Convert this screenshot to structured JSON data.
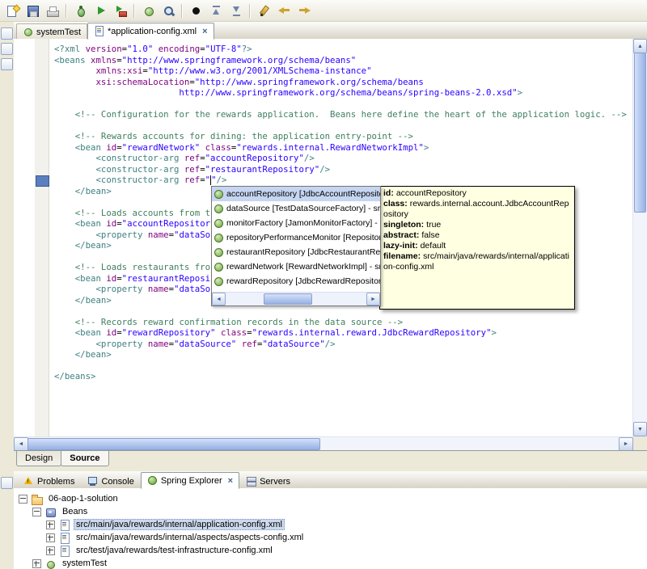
{
  "chrome": {
    "close": "×",
    "scroll_up": "▲",
    "scroll_down": "▼",
    "scroll_left": "◄",
    "scroll_right": "►"
  },
  "colors": {
    "window_bg": "#ece9d8",
    "tooltip_bg": "#ffffe1",
    "popup_selection": "#c6d5f1",
    "tree_selection": "#ccd9ed",
    "tag_color": "#3f7f7f",
    "attribute_color": "#7f007f",
    "value_color": "#2a00ff",
    "comment_color": "#3f7f5f"
  },
  "toolbar": {
    "items": [
      {
        "type": "icon",
        "name": "new-wizard"
      },
      {
        "type": "icon",
        "name": "save"
      },
      {
        "type": "icon",
        "name": "print"
      },
      {
        "type": "sep"
      },
      {
        "type": "icon",
        "name": "debug"
      },
      {
        "type": "icon",
        "name": "run"
      },
      {
        "type": "icon",
        "name": "external-tools"
      },
      {
        "type": "sep"
      },
      {
        "type": "icon",
        "name": "new-bean"
      },
      {
        "type": "icon",
        "name": "search"
      },
      {
        "type": "sep"
      },
      {
        "type": "icon",
        "name": "record"
      },
      {
        "type": "icon",
        "name": "prev-annotation"
      },
      {
        "type": "icon",
        "name": "next-annotation"
      },
      {
        "type": "sep"
      },
      {
        "type": "icon",
        "name": "last-edit-location"
      },
      {
        "type": "icon",
        "name": "back"
      },
      {
        "type": "icon",
        "name": "forward"
      }
    ]
  },
  "left_rail": {
    "icons": [
      {
        "name": "restore-fast-view-icon",
        "slot": "top"
      },
      {
        "name": "package-explorer-fast-view-icon",
        "slot": "top"
      },
      {
        "name": "outline-fast-view-icon",
        "slot": "top"
      },
      {
        "name": "spring-fast-view-icon",
        "slot": "bottom"
      }
    ]
  },
  "editor_tabs": [
    {
      "label": "systemTest",
      "icon": "eti-bean-file-icon",
      "active": false,
      "closable": false
    },
    {
      "label": "*application-config.xml",
      "icon": "eti-xml-file-icon",
      "active": true,
      "closable": true
    }
  ],
  "editor": {
    "lines": [
      [
        {
          "c": "tag",
          "t": "<?xml "
        },
        {
          "c": "attr",
          "t": "version"
        },
        {
          "c": "txt",
          "t": "="
        },
        {
          "c": "val",
          "t": "\"1.0\""
        },
        {
          "c": "txt",
          "t": " "
        },
        {
          "c": "attr",
          "t": "encoding"
        },
        {
          "c": "txt",
          "t": "="
        },
        {
          "c": "val",
          "t": "\"UTF-8\""
        },
        {
          "c": "tag",
          "t": "?>"
        }
      ],
      [
        {
          "c": "tag",
          "t": "<beans "
        },
        {
          "c": "attr",
          "t": "xmlns"
        },
        {
          "c": "txt",
          "t": "="
        },
        {
          "c": "val",
          "t": "\"http://www.springframework.org/schema/beans\""
        }
      ],
      [
        {
          "c": "txt",
          "t": "        "
        },
        {
          "c": "attr",
          "t": "xmlns:xsi"
        },
        {
          "c": "txt",
          "t": "="
        },
        {
          "c": "val",
          "t": "\"http://www.w3.org/2001/XMLSchema-instance\""
        }
      ],
      [
        {
          "c": "txt",
          "t": "        "
        },
        {
          "c": "attr",
          "t": "xsi:schemaLocation"
        },
        {
          "c": "txt",
          "t": "="
        },
        {
          "c": "val",
          "t": "\"http://www.springframework.org/schema/beans"
        }
      ],
      [
        {
          "c": "val",
          "t": "                        http://www.springframework.org/schema/beans/spring-beans-2.0.xsd\""
        },
        {
          "c": "tag",
          "t": ">"
        }
      ],
      [],
      [
        {
          "c": "txt",
          "t": "    "
        },
        {
          "c": "com",
          "t": "<!-- Configuration for the rewards application.  Beans here define the heart of the application logic. -->"
        }
      ],
      [],
      [
        {
          "c": "txt",
          "t": "    "
        },
        {
          "c": "com",
          "t": "<!-- Rewards accounts for dining: the application entry-point -->"
        }
      ],
      [
        {
          "c": "txt",
          "t": "    "
        },
        {
          "c": "tag",
          "t": "<bean "
        },
        {
          "c": "attr",
          "t": "id"
        },
        {
          "c": "txt",
          "t": "="
        },
        {
          "c": "val",
          "t": "\"rewardNetwork\""
        },
        {
          "c": "txt",
          "t": " "
        },
        {
          "c": "attr",
          "t": "class"
        },
        {
          "c": "txt",
          "t": "="
        },
        {
          "c": "val",
          "t": "\"rewards.internal.RewardNetworkImpl\""
        },
        {
          "c": "tag",
          "t": ">"
        }
      ],
      [
        {
          "c": "txt",
          "t": "        "
        },
        {
          "c": "tag",
          "t": "<constructor-arg "
        },
        {
          "c": "attr",
          "t": "ref"
        },
        {
          "c": "txt",
          "t": "="
        },
        {
          "c": "val",
          "t": "\"accountRepository\""
        },
        {
          "c": "tag",
          "t": "/>"
        }
      ],
      [
        {
          "c": "txt",
          "t": "        "
        },
        {
          "c": "tag",
          "t": "<constructor-arg "
        },
        {
          "c": "attr",
          "t": "ref"
        },
        {
          "c": "txt",
          "t": "="
        },
        {
          "c": "val",
          "t": "\"restaurantRepository\""
        },
        {
          "c": "tag",
          "t": "/>"
        }
      ],
      [
        {
          "c": "txt",
          "t": "        "
        },
        {
          "c": "tag",
          "t": "<constructor-arg "
        },
        {
          "c": "attr",
          "t": "ref"
        },
        {
          "c": "txt",
          "t": "="
        },
        {
          "c": "val",
          "t": "\""
        },
        {
          "caret": true
        },
        {
          "c": "val",
          "t": "\""
        },
        {
          "c": "tag",
          "t": "/>"
        }
      ],
      [
        {
          "c": "txt",
          "t": "    "
        },
        {
          "c": "tag",
          "t": "</bean>"
        }
      ],
      [],
      [
        {
          "c": "txt",
          "t": "    "
        },
        {
          "c": "com",
          "t": "<!-- Loads accounts from t"
        }
      ],
      [
        {
          "c": "txt",
          "t": "    "
        },
        {
          "c": "tag",
          "t": "<bean "
        },
        {
          "c": "attr",
          "t": "id"
        },
        {
          "c": "txt",
          "t": "="
        },
        {
          "c": "val",
          "t": "\"accountRepositor"
        }
      ],
      [
        {
          "c": "txt",
          "t": "        "
        },
        {
          "c": "tag",
          "t": "<property "
        },
        {
          "c": "attr",
          "t": "name"
        },
        {
          "c": "txt",
          "t": "="
        },
        {
          "c": "val",
          "t": "\"dataSo"
        }
      ],
      [
        {
          "c": "txt",
          "t": "    "
        },
        {
          "c": "tag",
          "t": "</bean>"
        }
      ],
      [],
      [
        {
          "c": "txt",
          "t": "    "
        },
        {
          "c": "com",
          "t": "<!-- Loads restaurants fro"
        }
      ],
      [
        {
          "c": "txt",
          "t": "    "
        },
        {
          "c": "tag",
          "t": "<bean "
        },
        {
          "c": "attr",
          "t": "id"
        },
        {
          "c": "txt",
          "t": "="
        },
        {
          "c": "val",
          "t": "\"restaurantReposi"
        }
      ],
      [
        {
          "c": "txt",
          "t": "        "
        },
        {
          "c": "tag",
          "t": "<property "
        },
        {
          "c": "attr",
          "t": "name"
        },
        {
          "c": "txt",
          "t": "="
        },
        {
          "c": "val",
          "t": "\"dataSo"
        }
      ],
      [
        {
          "c": "txt",
          "t": "    "
        },
        {
          "c": "tag",
          "t": "</bean>"
        }
      ],
      [],
      [
        {
          "c": "txt",
          "t": "    "
        },
        {
          "c": "com",
          "t": "<!-- Records reward confirmation records in the data source -->"
        }
      ],
      [
        {
          "c": "txt",
          "t": "    "
        },
        {
          "c": "tag",
          "t": "<bean "
        },
        {
          "c": "attr",
          "t": "id"
        },
        {
          "c": "txt",
          "t": "="
        },
        {
          "c": "val",
          "t": "\"rewardRepository\""
        },
        {
          "c": "txt",
          "t": " "
        },
        {
          "c": "attr",
          "t": "class"
        },
        {
          "c": "txt",
          "t": "="
        },
        {
          "c": "val",
          "t": "\"rewards.internal.reward.JdbcRewardRepository\""
        },
        {
          "c": "tag",
          "t": ">"
        }
      ],
      [
        {
          "c": "txt",
          "t": "        "
        },
        {
          "c": "tag",
          "t": "<property "
        },
        {
          "c": "attr",
          "t": "name"
        },
        {
          "c": "txt",
          "t": "="
        },
        {
          "c": "val",
          "t": "\"dataSource\""
        },
        {
          "c": "txt",
          "t": " "
        },
        {
          "c": "attr",
          "t": "ref"
        },
        {
          "c": "txt",
          "t": "="
        },
        {
          "c": "val",
          "t": "\"dataSource\""
        },
        {
          "c": "tag",
          "t": "/>"
        }
      ],
      [
        {
          "c": "txt",
          "t": "    "
        },
        {
          "c": "tag",
          "t": "</bean>"
        }
      ],
      [],
      [
        {
          "c": "tag",
          "t": "</beans>"
        }
      ]
    ]
  },
  "popup": {
    "items": [
      {
        "label": "accountRepository [JdbcAccountRepository] - src/m",
        "selected": true
      },
      {
        "label": "dataSource [TestDataSourceFactory] - src/test/ja",
        "selected": false
      },
      {
        "label": "monitorFactory [JamonMonitorFactory] - src/main",
        "selected": false
      },
      {
        "label": "repositoryPerformanceMonitor [RepositoryPerfor",
        "selected": false
      },
      {
        "label": "restaurantRepository [JdbcRestaurantRepository]",
        "selected": false
      },
      {
        "label": "rewardNetwork [RewardNetworkImpl] - src/main/j",
        "selected": false
      },
      {
        "label": "rewardRepository [JdbcRewardRepository] - src/m",
        "selected": false
      }
    ]
  },
  "tooltip": {
    "rows": [
      {
        "label": "id:",
        "value": "accountRepository"
      },
      {
        "label": "class:",
        "value": "rewards.internal.account.JdbcAccountRepository"
      },
      {
        "label": "singleton:",
        "value": "true"
      },
      {
        "label": "abstract:",
        "value": "false"
      },
      {
        "label": "lazy-init:",
        "value": "default"
      },
      {
        "label": "filename:",
        "value": "src/main/java/rewards/internal/application-config.xml"
      }
    ]
  },
  "source_tabs": [
    {
      "label": "Design",
      "active": false
    },
    {
      "label": "Source",
      "active": true
    }
  ],
  "bottom_tabs": [
    {
      "label": "Problems",
      "icon": "bti-problems-icon",
      "active": false,
      "closable": false
    },
    {
      "label": "Console",
      "icon": "bti-console-icon",
      "active": false,
      "closable": false
    },
    {
      "label": "Spring Explorer",
      "icon": "bti-spring-explorer-icon",
      "active": true,
      "closable": true
    },
    {
      "label": "Servers",
      "icon": "bti-servers-icon",
      "active": false,
      "closable": false
    }
  ],
  "tree": {
    "items": [
      {
        "level": 0,
        "expander": "minus",
        "icon": "ti-project-icon",
        "label": "06-aop-1-solution",
        "selected": false
      },
      {
        "level": 1,
        "expander": "minus",
        "icon": "ti-beans-node-icon",
        "label": "Beans",
        "selected": false
      },
      {
        "level": 2,
        "expander": "plus",
        "icon": "ti-config-file-icon",
        "label": "src/main/java/rewards/internal/application-config.xml",
        "selected": true
      },
      {
        "level": 2,
        "expander": "plus",
        "icon": "ti-config-file-icon",
        "label": "src/main/java/rewards/internal/aspects/aspects-config.xml",
        "selected": false
      },
      {
        "level": 2,
        "expander": "plus",
        "icon": "ti-config-file-icon",
        "label": "src/test/java/rewards/test-infrastructure-config.xml",
        "selected": false
      },
      {
        "level": 1,
        "expander": "plus",
        "icon": "ti-bean-icon",
        "label": "systemTest",
        "selected": false
      }
    ]
  }
}
